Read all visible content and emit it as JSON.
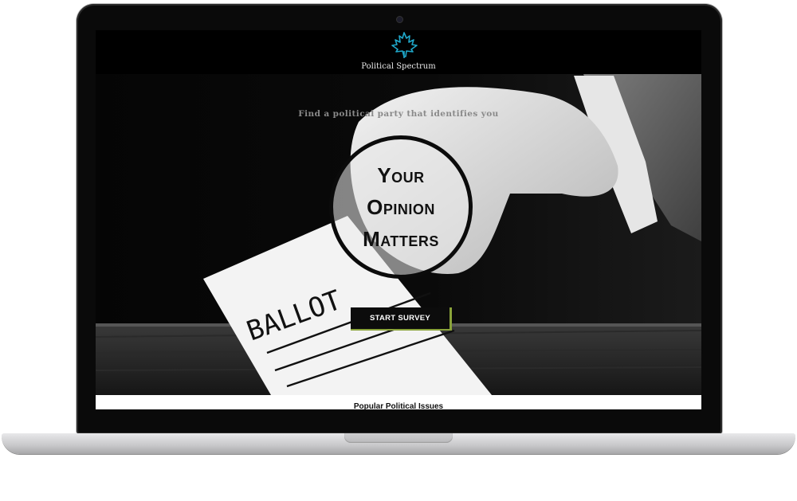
{
  "brand": {
    "name": "Political Spectrum",
    "icon": "maple-leaf-icon",
    "icon_color": "#1fa7c9"
  },
  "hero": {
    "tagline": "Find a political party that identifies you",
    "headline": [
      "Your",
      "Opinion",
      "Matters"
    ],
    "ballot_text": "BALLOT",
    "cta_label": "START SURVEY",
    "cta_accent": "#8aa33a"
  },
  "section": {
    "title": "Popular Political Issues"
  }
}
